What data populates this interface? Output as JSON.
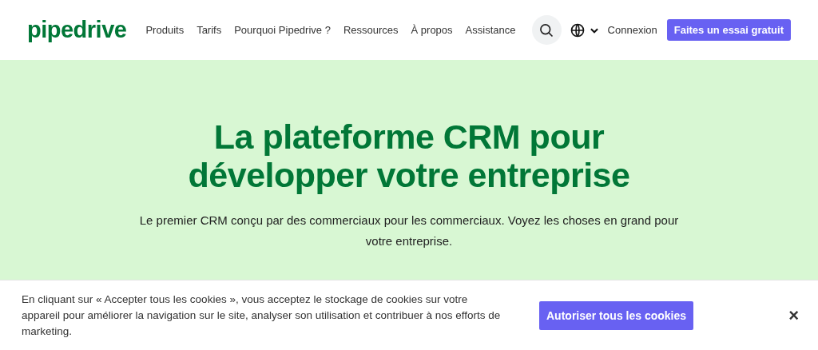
{
  "header": {
    "logo": "pipedrive",
    "nav": [
      {
        "label": "Produits"
      },
      {
        "label": "Tarifs"
      },
      {
        "label": "Pourquoi Pipedrive ?"
      },
      {
        "label": "Ressources"
      },
      {
        "label": "À propos"
      },
      {
        "label": "Assistance"
      }
    ],
    "login": "Connexion",
    "cta": "Faites un essai gratuit"
  },
  "hero": {
    "title": "La plateforme CRM pour développer votre entreprise",
    "subtitle": "Le premier CRM conçu par des commerciaux pour les commerciaux. Voyez les choses en grand pour votre entreprise."
  },
  "cookie_banner": {
    "text": "En cliquant sur « Accepter tous les cookies », vous acceptez le stockage de cookies sur votre appareil pour améliorer la navigation sur le site, analyser son utilisation et contribuer à nos efforts de marketing.",
    "button": "Autoriser tous les cookies",
    "close": "×"
  }
}
